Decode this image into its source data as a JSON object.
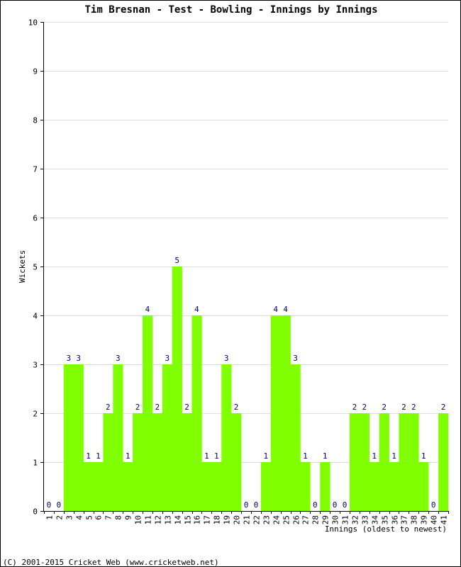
{
  "chart_data": {
    "type": "bar",
    "title": "Tim Bresnan - Test - Bowling - Innings by Innings",
    "xlabel": "Innings (oldest to newest)",
    "ylabel": "Wickets",
    "ylim": [
      0,
      10
    ],
    "yticks": [
      0,
      1,
      2,
      3,
      4,
      5,
      6,
      7,
      8,
      9,
      10
    ],
    "grid": true,
    "categories": [
      "1",
      "2",
      "3",
      "4",
      "5",
      "6",
      "7",
      "8",
      "9",
      "10",
      "11",
      "12",
      "13",
      "14",
      "15",
      "16",
      "17",
      "18",
      "19",
      "20",
      "21",
      "22",
      "23",
      "24",
      "25",
      "26",
      "27",
      "28",
      "29",
      "30",
      "31",
      "32",
      "33",
      "34",
      "35",
      "36",
      "37",
      "38",
      "39",
      "40",
      "41"
    ],
    "values": [
      0,
      0,
      3,
      3,
      1,
      1,
      2,
      3,
      1,
      2,
      4,
      2,
      3,
      5,
      2,
      4,
      1,
      1,
      3,
      2,
      0,
      0,
      1,
      4,
      4,
      3,
      1,
      0,
      1,
      0,
      0,
      2,
      2,
      1,
      2,
      1,
      2,
      2,
      1,
      0,
      2
    ],
    "bar_color": "#80ff00",
    "label_color": "#000080"
  },
  "footer": "(C) 2001-2015 Cricket Web (www.cricketweb.net)"
}
